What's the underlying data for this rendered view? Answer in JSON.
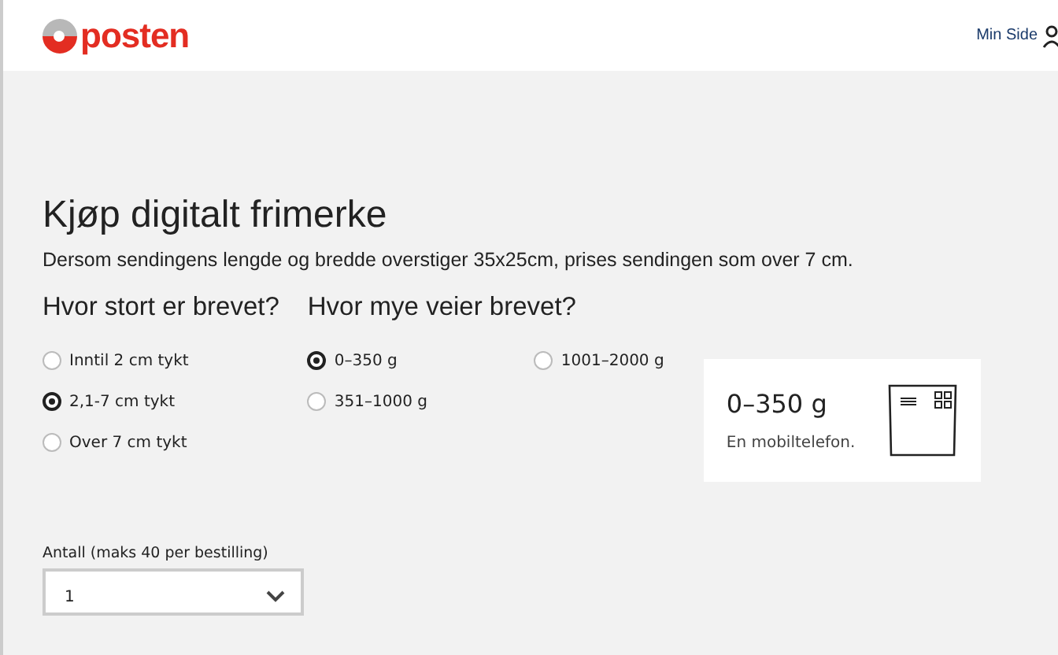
{
  "header": {
    "logo_text": "posten",
    "account_link": "Min Side"
  },
  "title": "Kjøp digitalt frimerke",
  "description": "Dersom sendingens lengde og bredde overstiger 35x25cm, prises sendingen som over 7 cm.",
  "size_group": {
    "heading": "Hvor stort er brevet?",
    "options": [
      {
        "label": "Inntil 2 cm tykt",
        "selected": false
      },
      {
        "label": "2,1-7 cm tykt",
        "selected": true
      },
      {
        "label": "Over 7 cm tykt",
        "selected": false
      }
    ]
  },
  "weight_group": {
    "heading": "Hvor mye veier brevet?",
    "options": [
      {
        "label": "0–350 g",
        "selected": true
      },
      {
        "label": "351–1000 g",
        "selected": false
      },
      {
        "label": "1001–2000 g",
        "selected": false
      }
    ]
  },
  "info_card": {
    "weight": "0–350 g",
    "example": "En mobiltelefon."
  },
  "quantity": {
    "label": "Antall (maks 40 per bestilling)",
    "value": "1"
  }
}
